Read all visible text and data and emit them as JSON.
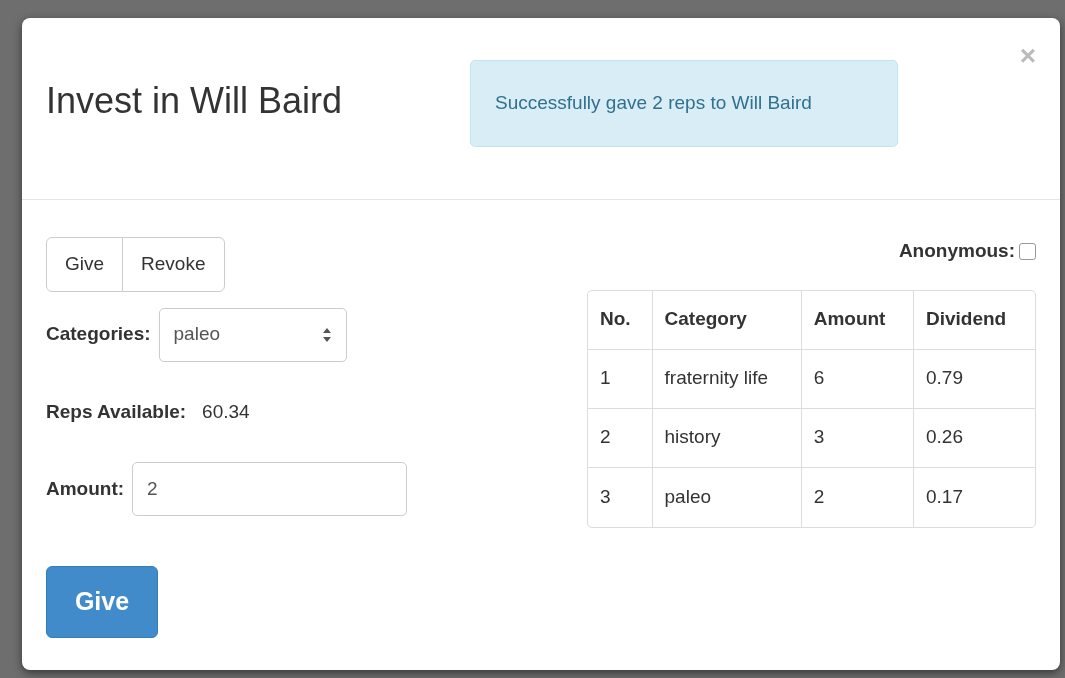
{
  "modal": {
    "title": "Invest in Will Baird",
    "alert": "Successfully gave 2 reps to Will Baird",
    "close": "×"
  },
  "mode_buttons": [
    "Give",
    "Revoke"
  ],
  "categories": {
    "label": "Categories:",
    "value": "paleo"
  },
  "reps": {
    "label": "Reps Available:",
    "value": "60.34"
  },
  "amount": {
    "label": "Amount:",
    "value": "2"
  },
  "submit": "Give",
  "anonymous": {
    "label": "Anonymous:",
    "checked": false
  },
  "table": {
    "columns": [
      "No.",
      "Category",
      "Amount",
      "Dividend"
    ],
    "rows": [
      [
        "1",
        "fraternity life",
        "6",
        "0.79"
      ],
      [
        "2",
        "history",
        "3",
        "0.26"
      ],
      [
        "3",
        "paleo",
        "2",
        "0.17"
      ]
    ]
  }
}
